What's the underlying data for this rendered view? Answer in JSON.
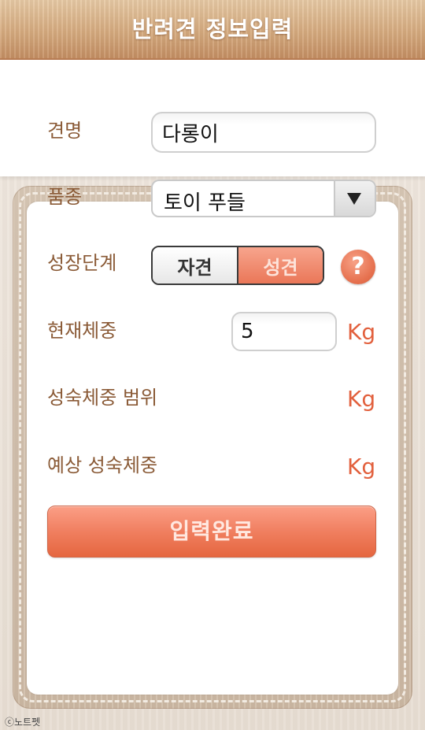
{
  "header": {
    "title": "반려견 정보입력"
  },
  "form": {
    "name": {
      "label": "견명",
      "value": "다롱이"
    },
    "breed": {
      "label": "품종",
      "selected": "토이 푸들"
    },
    "growth_stage": {
      "label": "성장단계",
      "options": [
        "자견",
        "성견"
      ],
      "selected": "성견",
      "help_label": "?"
    },
    "current_weight": {
      "label": "현재체중",
      "value": "5",
      "unit": "Kg"
    },
    "adult_weight_range": {
      "label": "성숙체중 범위",
      "value": "",
      "unit": "Kg"
    },
    "expected_adult_weight": {
      "label": "예상 성숙체중",
      "value": "",
      "unit": "Kg"
    },
    "submit_label": "입력완료"
  },
  "watermark": "ⓒ노트펫",
  "colors": {
    "accent": "#e9714f",
    "label": "#8a5a36",
    "unit": "#e2603d",
    "header": "#d6ab7f"
  }
}
